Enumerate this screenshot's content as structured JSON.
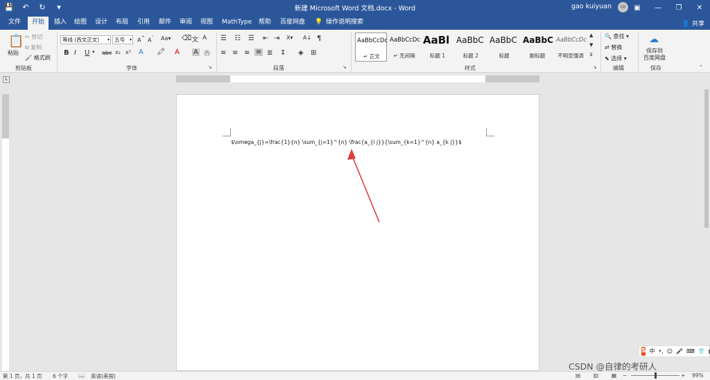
{
  "titlebar": {
    "title": "新建 Microsoft Word 文档.docx - Word",
    "user": "gao kuiyuan",
    "avatar": "GK",
    "icons": [
      "save-icon",
      "undo-icon",
      "redo-icon",
      "customize-icon"
    ]
  },
  "tabs": [
    "文件",
    "开始",
    "插入",
    "绘图",
    "设计",
    "布局",
    "引用",
    "邮件",
    "审阅",
    "视图",
    "MathType",
    "帮助",
    "百度网盘",
    "操作说明搜索"
  ],
  "active_tab": "开始",
  "share": "共享",
  "ribbon": {
    "clipboard": {
      "paste": "粘贴",
      "cut": "剪切",
      "copy": "复制",
      "format_painter": "格式刷",
      "label": "剪贴板"
    },
    "font": {
      "font_name": "等线 (西文正文)",
      "font_size": "五号",
      "label": "字体"
    },
    "paragraph": {
      "label": "段落"
    },
    "styles": {
      "label": "样式",
      "items": [
        {
          "sample": "AaBbCcDc",
          "name": "↵ 正文"
        },
        {
          "sample": "AaBbCcDc",
          "name": "↵ 无间隔"
        },
        {
          "sample": "AaBl",
          "name": "标题 1"
        },
        {
          "sample": "AaBbC",
          "name": "标题 2"
        },
        {
          "sample": "AaBbC",
          "name": "标题"
        },
        {
          "sample": "AaBbC",
          "name": "副标题"
        },
        {
          "sample": "AaBbCcDc",
          "name": "不明显强调"
        }
      ]
    },
    "editing": {
      "find": "查找",
      "replace": "替换",
      "select": "选择",
      "label": "编辑"
    },
    "save": {
      "button": "保存到\n百度网盘",
      "label": "保存"
    }
  },
  "document": {
    "text": "$\\omega_{j}=\\frac{1}{n} \\sum_{j=1}^{n} \\frac{a_{i j}}{\\sum_{k=1}^{n} a_{k j}}$"
  },
  "statusbar": {
    "page": "第 1 页，共 1 页",
    "words": "6 个字",
    "lang": "英语(美国)",
    "zoom": "99%"
  },
  "ime": {
    "logo": "S",
    "items": [
      "中",
      "•,",
      "☺",
      "🎤",
      "⌨",
      "👕",
      "▦"
    ]
  },
  "watermark": "CSDN @自律的考研人",
  "colors": {
    "brand": "#2b579a",
    "arrow": "#e03c3c"
  }
}
